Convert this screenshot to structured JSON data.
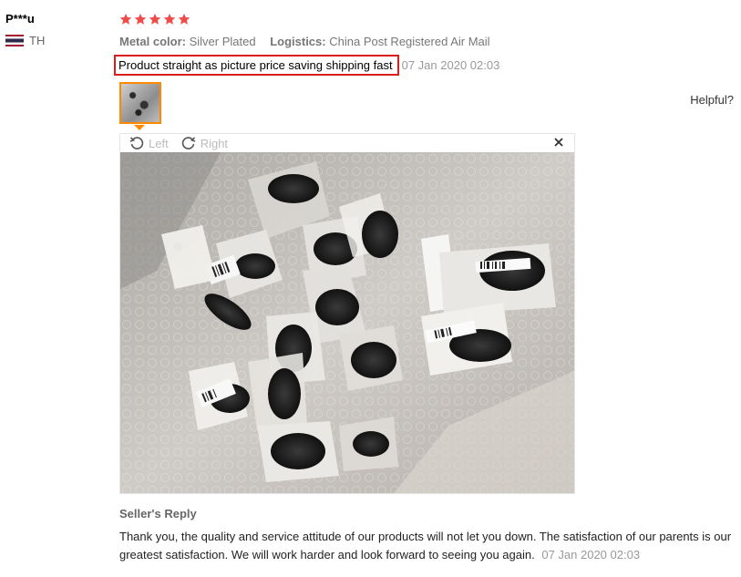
{
  "user": {
    "name": "P***u",
    "country": "TH",
    "flag_icon": "thailand-flag-icon"
  },
  "review": {
    "rating": 5,
    "star_color": "#ef4d4a",
    "attributes": [
      {
        "label": "Metal color:",
        "value": "Silver Plated"
      },
      {
        "label": "Logistics:",
        "value": "China Post Registered Air Mail"
      }
    ],
    "text": "Product straight as picture price saving shipping fast",
    "date": "07 Jan 2020 02:03",
    "helpful_label": "Helpful?"
  },
  "viewer": {
    "rotate_left_label": "Left",
    "rotate_right_label": "Right",
    "rotate_left_icon": "rotate-left-icon",
    "rotate_right_icon": "rotate-right-icon",
    "close_icon": "close-icon"
  },
  "seller_reply": {
    "title": "Seller's Reply",
    "text": "Thank you, the quality and service attitude of our products will not let you down. The satisfaction of our parents is our greatest satisfaction. We will work harder and look forward to seeing you again.",
    "date": "07 Jan 2020 02:03"
  },
  "colors": {
    "highlight_border": "#d9201f",
    "thumb_border": "#ff8a00"
  }
}
